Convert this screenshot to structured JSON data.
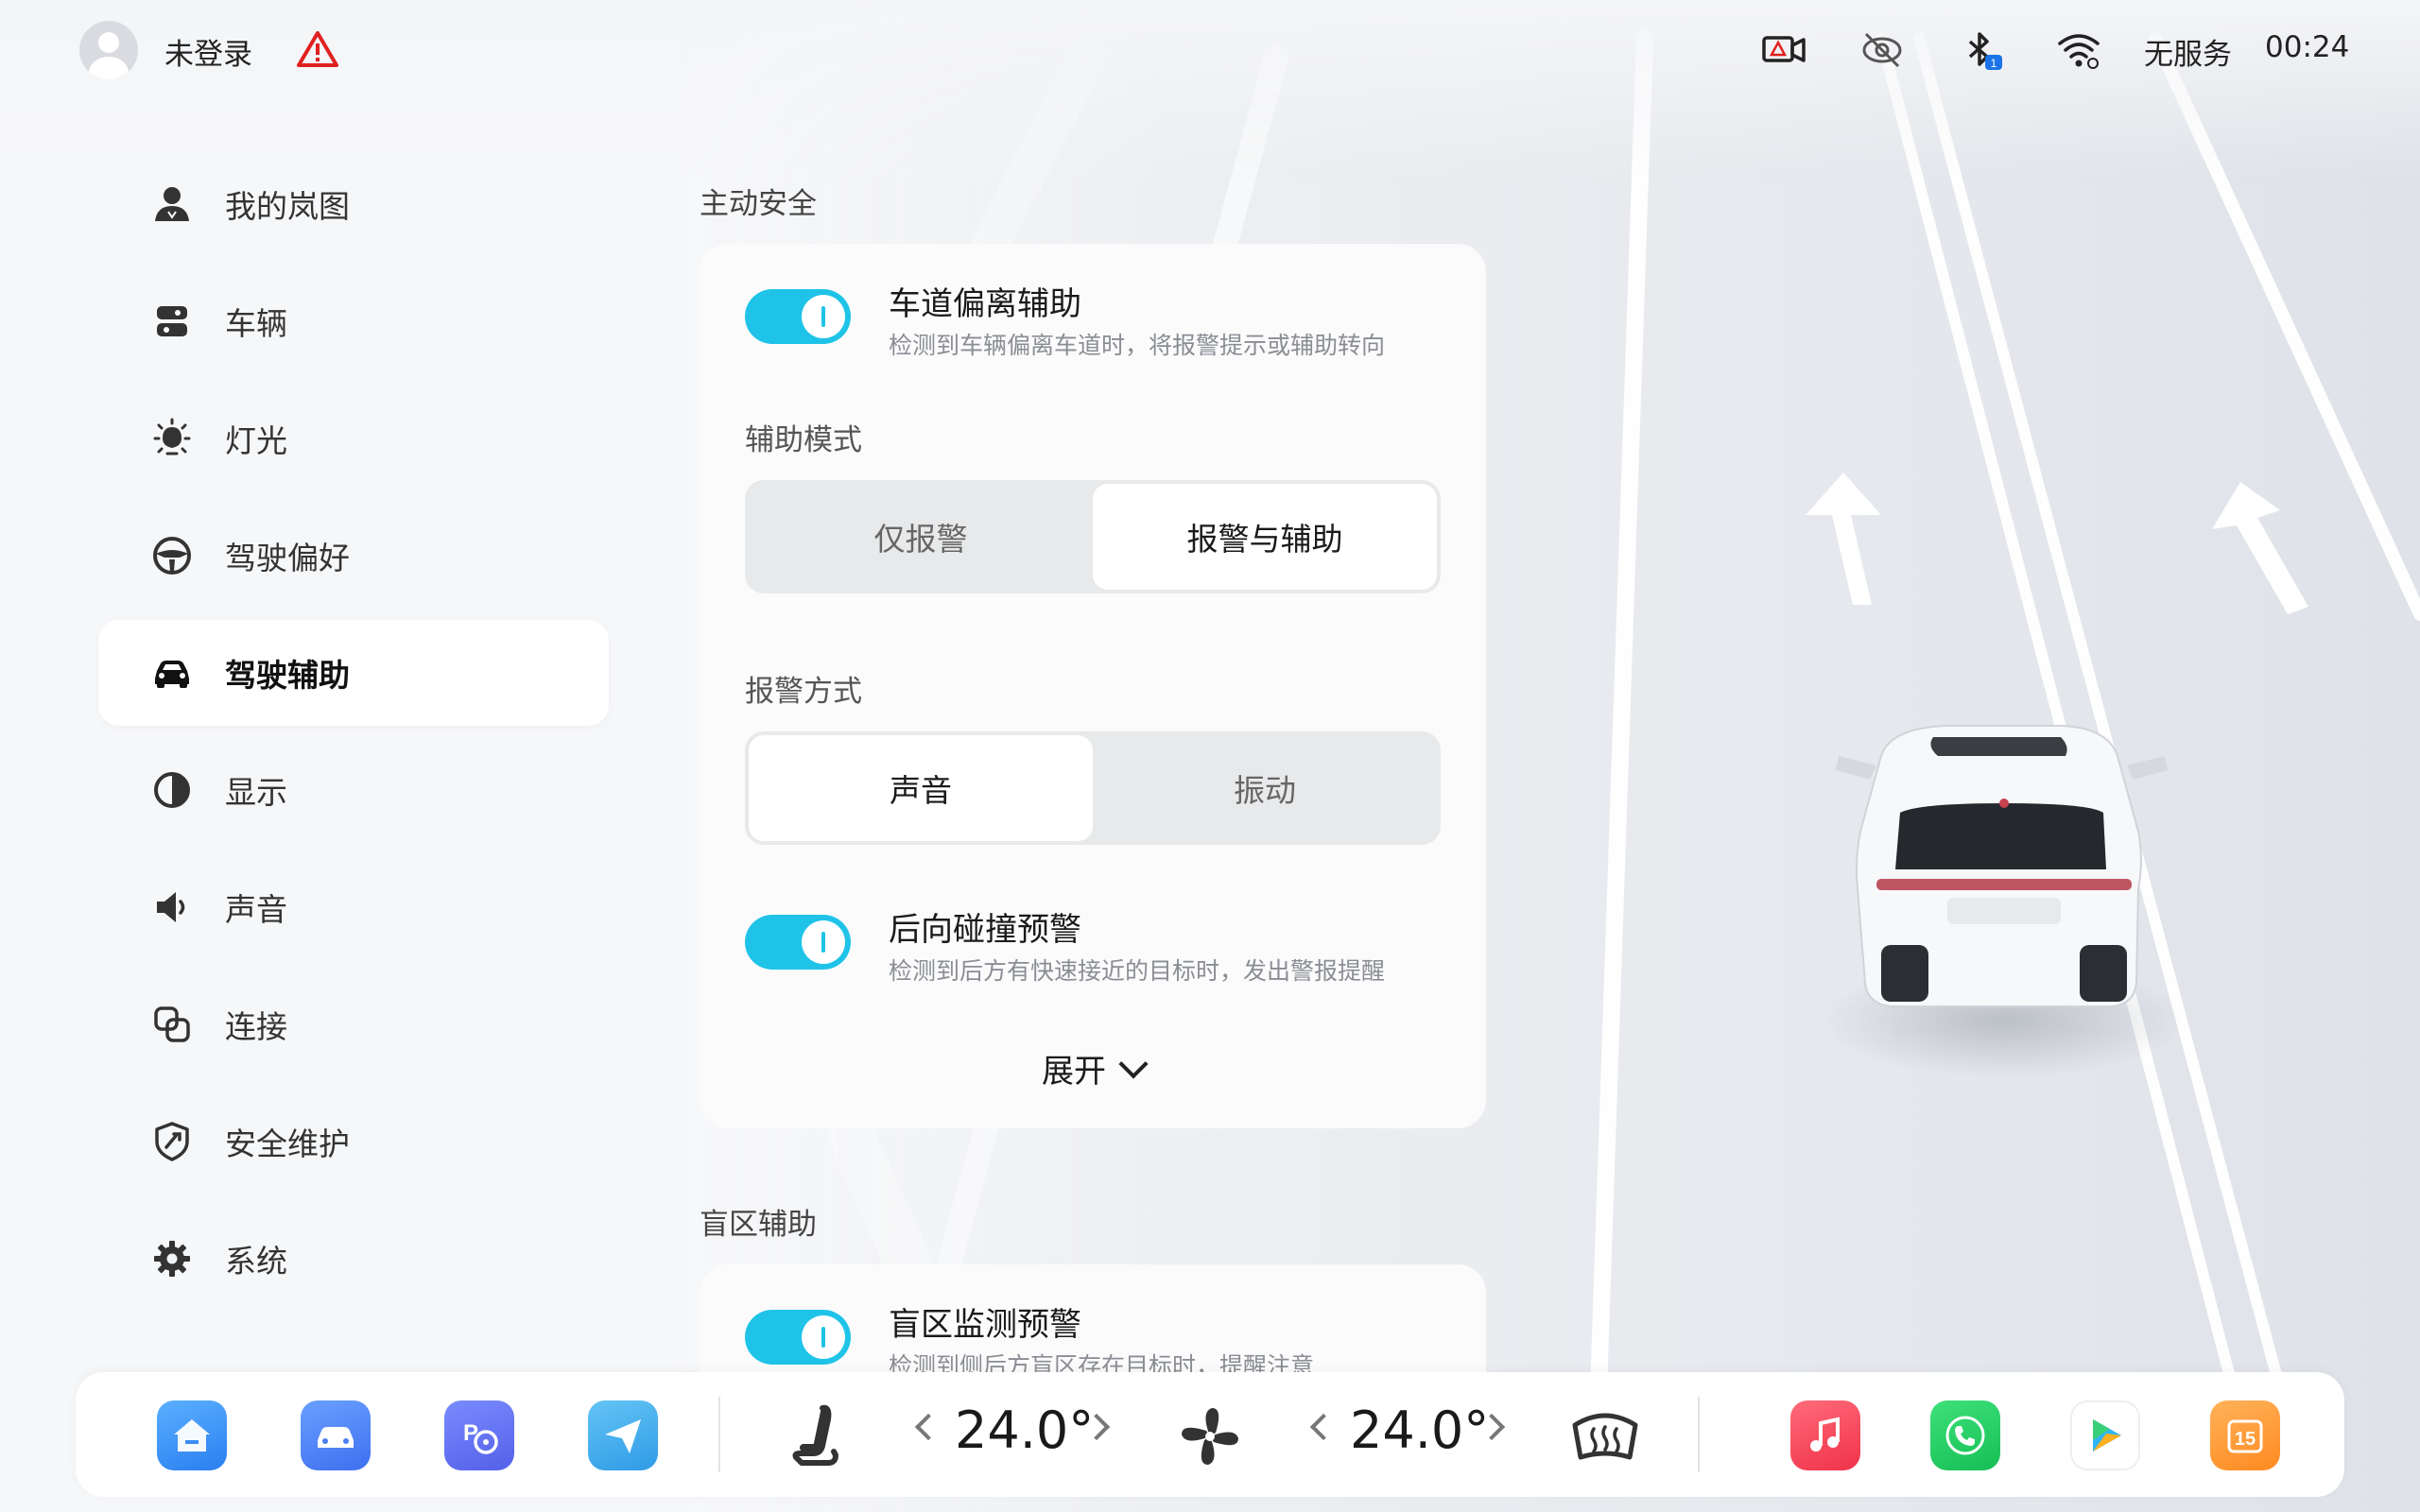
{
  "status_bar": {
    "login_text": "未登录",
    "network_text": "无服务",
    "time": "00:24",
    "bluetooth_badge": "1"
  },
  "sidebar": {
    "items": [
      {
        "label": "我的岚图",
        "icon": "profile-icon"
      },
      {
        "label": "车辆",
        "icon": "vehicle-icon"
      },
      {
        "label": "灯光",
        "icon": "light-icon"
      },
      {
        "label": "驾驶偏好",
        "icon": "steering-wheel-icon"
      },
      {
        "label": "驾驶辅助",
        "icon": "car-icon",
        "active": true
      },
      {
        "label": "显示",
        "icon": "display-icon"
      },
      {
        "label": "声音",
        "icon": "speaker-icon"
      },
      {
        "label": "连接",
        "icon": "connection-icon"
      },
      {
        "label": "安全维护",
        "icon": "shield-icon"
      },
      {
        "label": "系统",
        "icon": "gear-icon"
      }
    ]
  },
  "active_safety": {
    "section_title": "主动安全",
    "lane_departure": {
      "title": "车道偏离辅助",
      "desc": "检测到车辆偏离车道时，将报警提示或辅助转向",
      "enabled": true
    },
    "assist_mode": {
      "title": "辅助模式",
      "options": [
        "仅报警",
        "报警与辅助"
      ],
      "selected": "报警与辅助"
    },
    "alert_method": {
      "title": "报警方式",
      "options": [
        "声音",
        "振动"
      ],
      "selected": "声音"
    },
    "rear_collision": {
      "title": "后向碰撞预警",
      "desc": "检测到后方有快速接近的目标时，发出警报提醒",
      "enabled": true
    },
    "expand_label": "展开"
  },
  "blind_spot": {
    "section_title": "盲区辅助",
    "monitor": {
      "title": "盲区监测预警",
      "desc": "检测到侧后方盲区存在目标时，提醒注意",
      "enabled": true
    }
  },
  "dock": {
    "left_temp": "24.0°",
    "right_temp": "24.0°",
    "apps_left": [
      "home-app-icon",
      "car-app-icon",
      "parking-app-icon",
      "navigation-app-icon"
    ],
    "apps_right": [
      "music-app-icon",
      "phone-app-icon",
      "video-app-icon",
      "calendar-app-icon"
    ],
    "calendar_day": "15"
  },
  "colors": {
    "accent": "#1fc3e8",
    "warning": "#e02020",
    "background": "#eef0f4"
  }
}
